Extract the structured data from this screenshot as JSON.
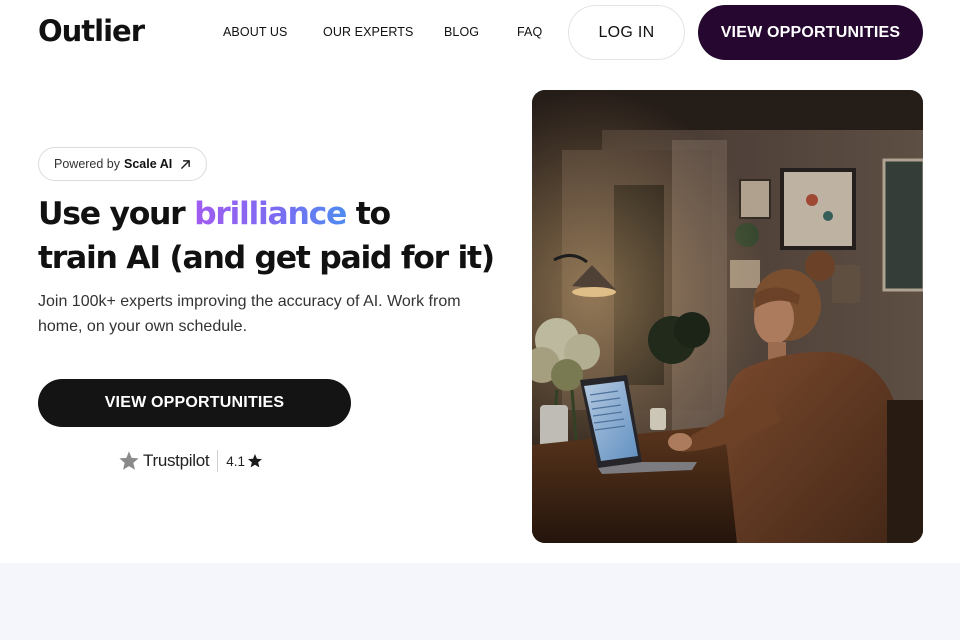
{
  "header": {
    "logo": "Outlier",
    "nav": [
      "ABOUT US",
      "OUR EXPERTS",
      "BLOG",
      "FAQ"
    ],
    "login_label": "LOG IN",
    "cta_label": "VIEW OPPORTUNITIES"
  },
  "hero": {
    "pill_prefix": "Powered by",
    "pill_brand": "Scale AI",
    "pill_icon": "arrow-up-right-icon",
    "headline_part1": "Use your ",
    "headline_accent": "brilliance",
    "headline_part2": " to",
    "headline_line2": "train AI (and get paid for it)",
    "subtext": "Join 100k+ experts improving the accuracy of AI. Work from home, on your own schedule.",
    "cta_label": "VIEW OPPORTUNITIES",
    "trustpilot": {
      "name": "Trustpilot",
      "rating": "4.1"
    },
    "image_icon": "woman-working-on-laptop-photo"
  },
  "colors": {
    "header_cta_bg": "#25072f",
    "hero_cta_bg": "#141414",
    "accent_gradient_start": "#a15cf0",
    "accent_gradient_end": "#4e8cf0",
    "band_bg": "#f5f5fc"
  }
}
